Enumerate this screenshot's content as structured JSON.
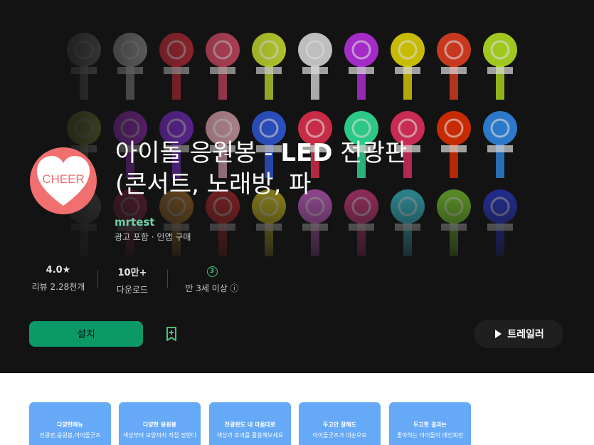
{
  "app": {
    "title_part1": "아이돌 응원봉 - ",
    "title_bold": "LED",
    "title_part2": " 전광판",
    "title_line2": "(콘서트, 노래방, 파",
    "icon_text": "CHEER",
    "developer": "mrtest",
    "ads_note": "광고 포함 · 인앱 구매"
  },
  "stats": {
    "rating_value": "4.0★",
    "rating_label": "리뷰 2.28천개",
    "downloads_value": "10만+",
    "downloads_label": "다운로드",
    "age_badge": "3",
    "age_label": "만 3세 이상 ⓘ"
  },
  "actions": {
    "install_label": "설치",
    "trailer_label": "트레일러"
  },
  "screenshots": [
    {
      "title": "다양한메뉴",
      "subtitle": "전광판,응원봉,아이돌굿즈"
    },
    {
      "title": "다양한 응원봉",
      "subtitle": "색상부터 모양까지 직접 정한다"
    },
    {
      "title": "전광판도 내 마음대로",
      "subtitle": "색상과 효과를 활용해보세요"
    },
    {
      "title": "두고만 잘해도",
      "subtitle": "아이돌굿즈가 대손으로"
    },
    {
      "title": "두고한 결과는",
      "subtitle": "좋아하는 아이돌이 데인회전"
    }
  ],
  "colors": {
    "hero_bg": "#131314",
    "accent_green": "#0b9968",
    "icon_bg": "#f16f6f",
    "screenshot_bg": "#65a9f7"
  },
  "icons": [
    "heart-logo",
    "star-icon",
    "info-icon",
    "bookmark-add-icon",
    "play-icon"
  ]
}
